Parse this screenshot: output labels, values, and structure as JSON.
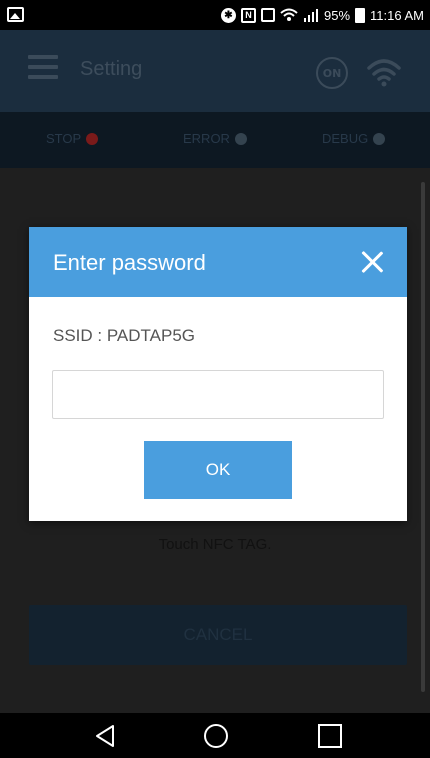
{
  "status_bar": {
    "battery_text": "95%",
    "time": "11:16 AM",
    "icons": [
      "gallery-icon",
      "bluetooth-icon",
      "nfc-icon",
      "vibrate-icon",
      "wifi-calling-icon",
      "signal-icon",
      "battery-icon"
    ]
  },
  "app": {
    "title": "Setting",
    "on_badge": "ON",
    "status": {
      "stop": "STOP",
      "error": "ERROR",
      "debug": "DEBUG",
      "stop_color": "#7a1a1a",
      "error_color": "#34434f",
      "debug_color": "#34434f"
    },
    "nfc_text": "Touch NFC TAG.",
    "cancel_label": "CANCEL"
  },
  "dialog": {
    "title": "Enter password",
    "ssid_label": "SSID : PADTAP5G",
    "password_value": "",
    "ok_label": "OK",
    "accent_color": "#4a9ede"
  }
}
